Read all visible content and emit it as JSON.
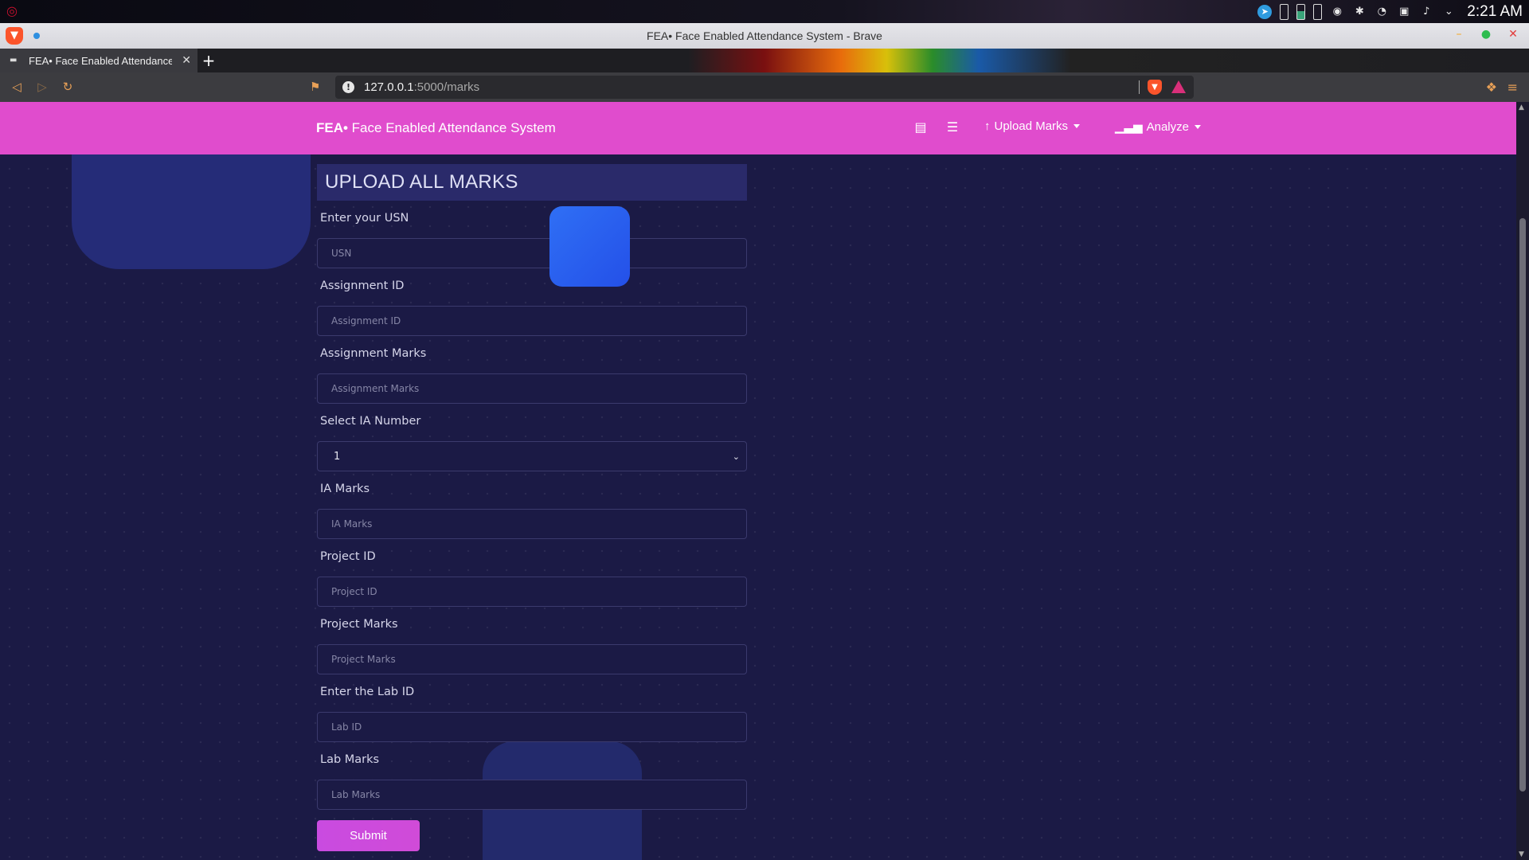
{
  "os": {
    "clock": "2:21 AM",
    "tray_icons": [
      "telegram-icon",
      "battery-icon",
      "battery-icon",
      "battery-icon",
      "vpn-icon",
      "bluetooth-icon",
      "wifi-icon",
      "display-icon",
      "volume-icon",
      "chevron-down-icon"
    ]
  },
  "browser": {
    "window_title": "FEA• Face Enabled Attendance System - Brave",
    "tab_title": "FEA• Face Enabled Attendance System",
    "url_host": "127.0.0.1",
    "url_path": ":5000/marks"
  },
  "navbar": {
    "brand_strong": "FEA•",
    "brand_text": " Face Enabled Attendance System",
    "menu": [
      {
        "label": "Upload Marks",
        "icon": "upload-icon"
      },
      {
        "label": "Analyze",
        "icon": "bar-chart-icon"
      }
    ],
    "icon_links": [
      "attendance-icon",
      "report-icon"
    ]
  },
  "form": {
    "heading": "UPLOAD ALL MARKS",
    "fields": [
      {
        "label": "Enter your USN",
        "placeholder": "USN"
      },
      {
        "label": "Assignment ID",
        "placeholder": "Assignment ID"
      },
      {
        "label": "Assignment Marks",
        "placeholder": "Assignment Marks"
      },
      {
        "label": "Select IA Number",
        "selected": "1"
      },
      {
        "label": "IA Marks",
        "placeholder": "IA Marks"
      },
      {
        "label": "Project ID",
        "placeholder": "Project ID"
      },
      {
        "label": "Project Marks",
        "placeholder": "Project Marks"
      },
      {
        "label": "Enter the Lab ID",
        "placeholder": "Lab ID"
      },
      {
        "label": "Lab Marks",
        "placeholder": "Lab Marks"
      }
    ],
    "submit_label": "Submit"
  },
  "colors": {
    "navbar": "#e04ccd",
    "page_background": "#1b1a45",
    "heading_bar": "#2a2a6a",
    "submit_button": "#c94be0",
    "accent_blue": "#2f6ff5"
  }
}
